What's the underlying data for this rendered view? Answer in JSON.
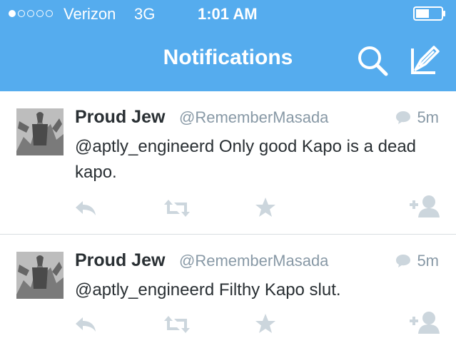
{
  "status_bar": {
    "carrier": "Verizon",
    "network": "3G",
    "time": "1:01 AM"
  },
  "nav": {
    "title": "Notifications"
  },
  "tweets": [
    {
      "name": "Proud Jew",
      "handle": "@RememberMasada",
      "time": "5m",
      "text": "@aptly_engineerd Only good Kapo is a dead kapo."
    },
    {
      "name": "Proud Jew",
      "handle": "@RememberMasada",
      "time": "5m",
      "text": "@aptly_engineerd Filthy Kapo slut."
    }
  ],
  "colors": {
    "brand": "#55acee",
    "secondary_text": "#8899a6",
    "action_icons": "#ccd6dd"
  }
}
